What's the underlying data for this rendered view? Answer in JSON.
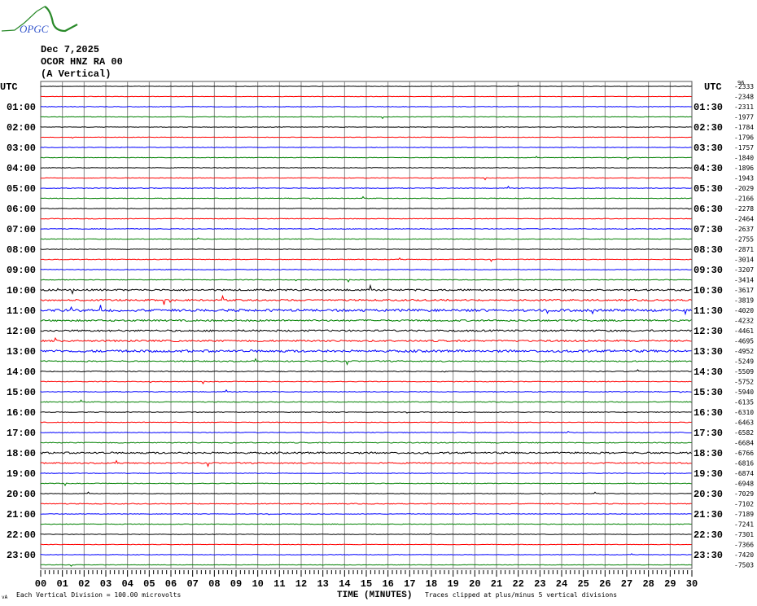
{
  "header": {
    "logo_text": "OPGC",
    "date": "Dec 7,2025",
    "station": "OCOR HNZ RA 00",
    "component": "(A Vertical)"
  },
  "chart_data": {
    "type": "line",
    "title": "Helicorder OCOR HNZ RA 00",
    "left_axis_title": "UTC",
    "right_axis_title": "UTC",
    "right_top_extra": "96",
    "left_labels": [
      "01:00",
      "02:00",
      "03:00",
      "04:00",
      "05:00",
      "06:00",
      "07:00",
      "08:00",
      "09:00",
      "10:00",
      "11:00",
      "12:00",
      "13:00",
      "14:00",
      "15:00",
      "16:00",
      "17:00",
      "18:00",
      "19:00",
      "20:00",
      "21:00",
      "22:00",
      "23:00"
    ],
    "right_labels": [
      "01:30",
      "02:30",
      "03:30",
      "04:30",
      "05:30",
      "06:30",
      "07:30",
      "08:30",
      "09:30",
      "10:30",
      "11:30",
      "12:30",
      "13:30",
      "14:30",
      "15:30",
      "16:30",
      "17:30",
      "18:30",
      "19:30",
      "20:30",
      "21:30",
      "22:30",
      "23:30"
    ],
    "trace_offsets": [
      "-2333",
      "-2348",
      "-2311",
      "-1977",
      "-1784",
      "-1796",
      "-1757",
      "-1840",
      "-1896",
      "-1943",
      "-2029",
      "-2166",
      "-2278",
      "-2464",
      "-2637",
      "-2755",
      "-2871",
      "-3014",
      "-3207",
      "-3414",
      "-3617",
      "-3819",
      "-4020",
      "-4232",
      "-4461",
      "-4695",
      "-4952",
      "-5249",
      "-5509",
      "-5752",
      "-5940",
      "-6135",
      "-6310",
      "-6463",
      "-6582",
      "-6684",
      "-6766",
      "-6816",
      "-6874",
      "-6948",
      "-7029",
      "-7102",
      "-7189",
      "-7241",
      "-7301",
      "-7366",
      "-7420",
      "-7503"
    ],
    "trace_colors": [
      "#000000",
      "#ff0000",
      "#0000ff",
      "#008000"
    ],
    "relative_amplitude": [
      0.3,
      0.3,
      0.5,
      0.5,
      0.4,
      0.4,
      0.5,
      0.5,
      0.5,
      0.5,
      0.6,
      0.6,
      0.5,
      0.6,
      0.6,
      0.6,
      0.5,
      0.6,
      0.6,
      0.6,
      1.5,
      1.5,
      2,
      1.5,
      1.5,
      1.5,
      2,
      1,
      0.8,
      0.6,
      0.6,
      0.7,
      0.6,
      0.6,
      0.6,
      0.8,
      1.5,
      1,
      0.5,
      0.6,
      0.5,
      0.7,
      0.5,
      0.6,
      0.4,
      0.4,
      0.4,
      0.4
    ],
    "x_ticks": [
      "00",
      "01",
      "02",
      "03",
      "04",
      "05",
      "06",
      "07",
      "08",
      "09",
      "10",
      "11",
      "12",
      "13",
      "14",
      "15",
      "16",
      "17",
      "18",
      "19",
      "20",
      "21",
      "22",
      "23",
      "24",
      "25",
      "26",
      "27",
      "28",
      "29",
      "30"
    ],
    "xlabel": "TIME (MINUTES)",
    "xlim": [
      0,
      30
    ],
    "scale_note": "Each Vertical Division =  100.00 microvolts",
    "clip_note": "Traces clipped at plus/minus 5 vertical divisions",
    "corner_mark": "vA",
    "grid": true
  }
}
